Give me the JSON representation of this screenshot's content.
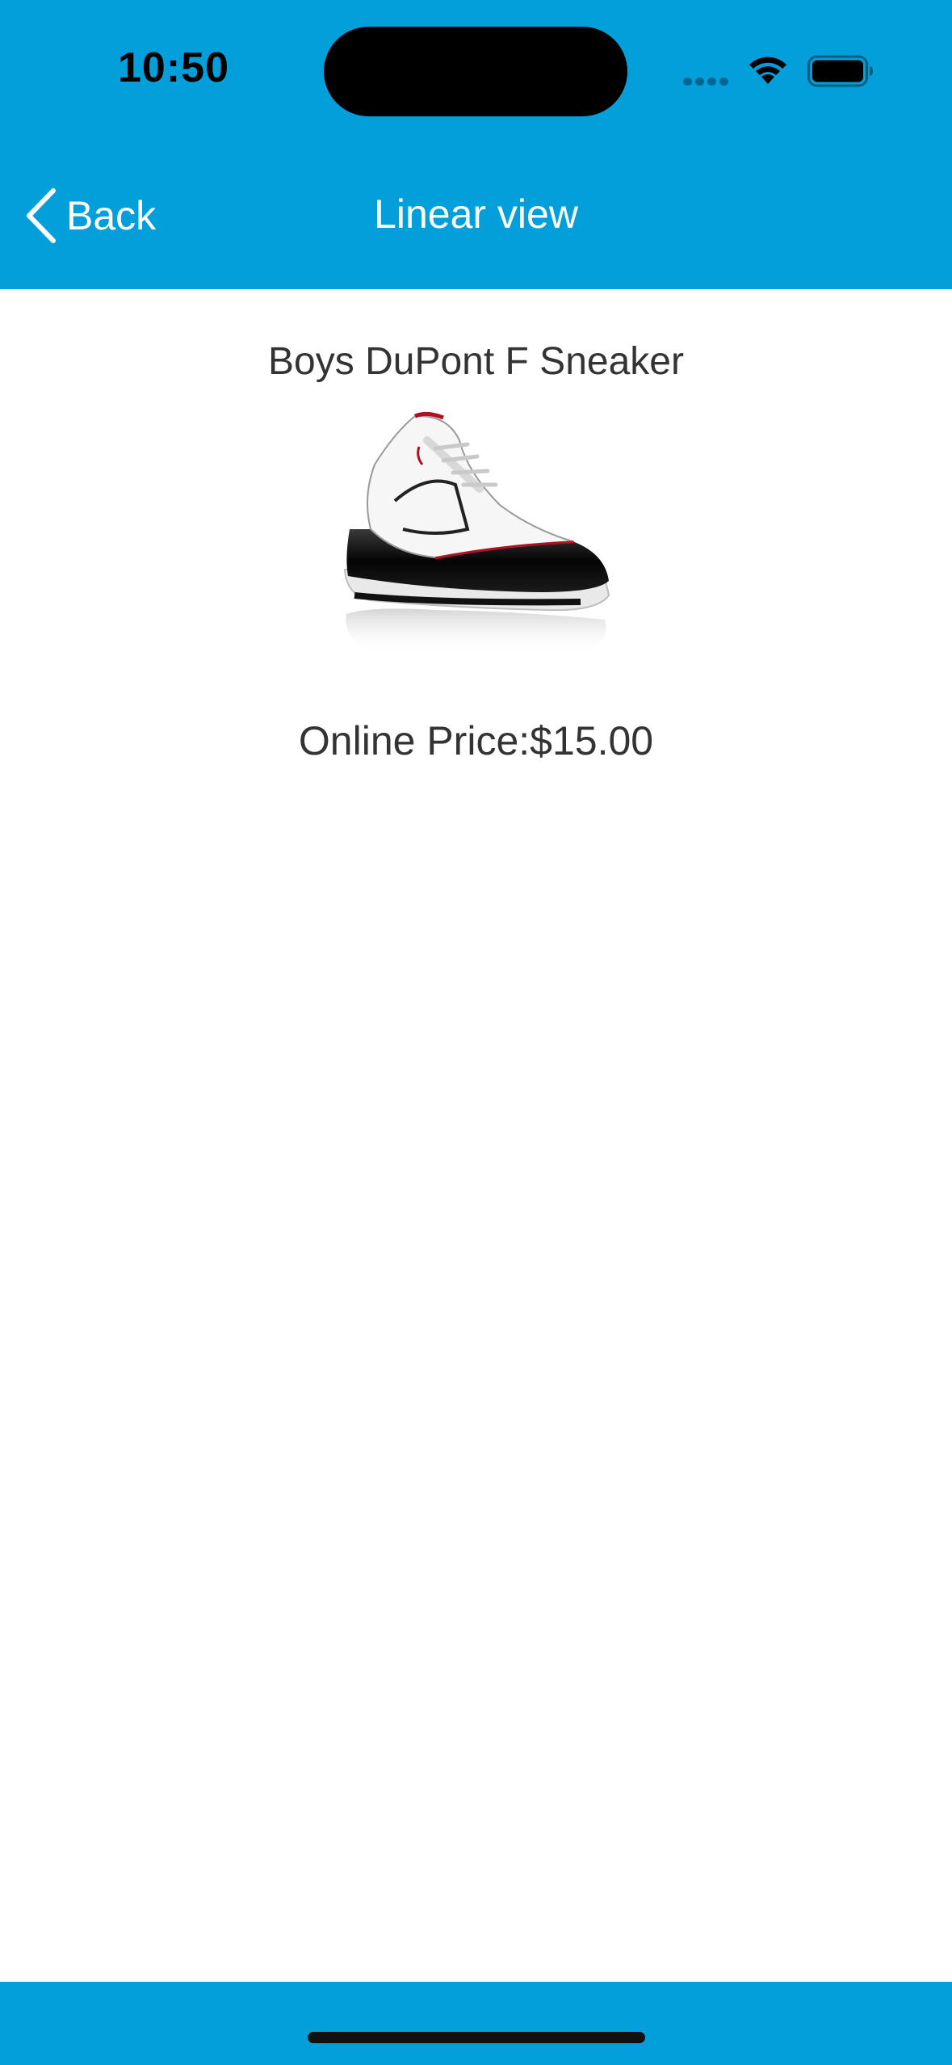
{
  "status_bar": {
    "time": "10:50"
  },
  "nav": {
    "back_label": "Back",
    "title": "Linear view"
  },
  "product": {
    "name": "Boys DuPont F Sneaker",
    "price_label": "Online Price:",
    "price_value": "$15.00"
  },
  "icons": {
    "back": "chevron-left-icon",
    "wifi": "wifi-icon",
    "battery": "battery-icon",
    "signal": "cell-signal-icon"
  },
  "colors": {
    "bar_background": "#029fdb",
    "text_primary": "#333333",
    "nav_text": "#ffffff"
  }
}
